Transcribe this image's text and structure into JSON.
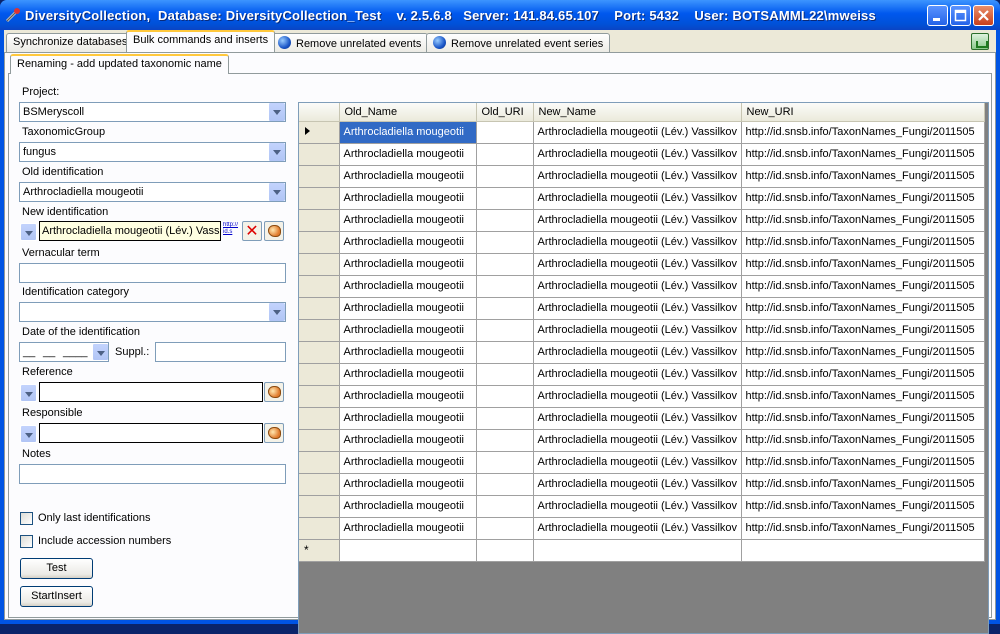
{
  "window": {
    "title": "DiversityCollection,  Database: DiversityCollection_Test    v. 2.5.6.8   Server: 141.84.65.107    Port: 5432    User: BOTSAMML22\\mweiss"
  },
  "tabs": [
    {
      "label": "Synchronize databases"
    },
    {
      "label": "Bulk commands and inserts"
    },
    {
      "label": "Remove unrelated events"
    },
    {
      "label": "Remove unrelated event series"
    }
  ],
  "subtab": {
    "label": "Renaming - add updated taxonomic name"
  },
  "form": {
    "project_label": "Project:",
    "project_value": "BSMeryscoll",
    "taxonomic_group_label": "TaxonomicGroup",
    "taxonomic_group_value": "fungus",
    "old_identification_label": "Old identification",
    "old_identification_value": "Arthrocladiella mougeotii",
    "new_identification_label": "New identification",
    "new_identification_value": "Arthrocladiella mougeotii (Lév.) Vassil",
    "new_identification_link": "http://id.s",
    "vernacular_label": "Vernacular term",
    "vernacular_value": "",
    "category_label": "Identification category",
    "category_value": "",
    "date_label": "Date of the identification",
    "date_day": "__",
    "date_month": "__",
    "date_year": "____",
    "suppl_label": "Suppl.:",
    "suppl_value": "",
    "reference_label": "Reference",
    "reference_value": "",
    "responsible_label": "Responsible",
    "responsible_value": "",
    "notes_label": "Notes",
    "notes_value": "",
    "only_last_label": "Only last identifications",
    "only_last_checked": false,
    "include_accession_label": "Include accession numbers",
    "include_accession_checked": false,
    "test_button": "Test",
    "start_button": "StartInsert"
  },
  "grid": {
    "columns": [
      "Old_Name",
      "Old_URI",
      "New_Name",
      "New_URI"
    ],
    "rows": [
      [
        "Arthrocladiella mougeotii",
        "",
        "Arthrocladiella mougeotii (Lév.) Vassilkov",
        "http://id.snsb.info/TaxonNames_Fungi/2011505"
      ],
      [
        "Arthrocladiella mougeotii",
        "",
        "Arthrocladiella mougeotii (Lév.) Vassilkov",
        "http://id.snsb.info/TaxonNames_Fungi/2011505"
      ],
      [
        "Arthrocladiella mougeotii",
        "",
        "Arthrocladiella mougeotii (Lév.) Vassilkov",
        "http://id.snsb.info/TaxonNames_Fungi/2011505"
      ],
      [
        "Arthrocladiella mougeotii",
        "",
        "Arthrocladiella mougeotii (Lév.) Vassilkov",
        "http://id.snsb.info/TaxonNames_Fungi/2011505"
      ],
      [
        "Arthrocladiella mougeotii",
        "",
        "Arthrocladiella mougeotii (Lév.) Vassilkov",
        "http://id.snsb.info/TaxonNames_Fungi/2011505"
      ],
      [
        "Arthrocladiella mougeotii",
        "",
        "Arthrocladiella mougeotii (Lév.) Vassilkov",
        "http://id.snsb.info/TaxonNames_Fungi/2011505"
      ],
      [
        "Arthrocladiella mougeotii",
        "",
        "Arthrocladiella mougeotii (Lév.) Vassilkov",
        "http://id.snsb.info/TaxonNames_Fungi/2011505"
      ],
      [
        "Arthrocladiella mougeotii",
        "",
        "Arthrocladiella mougeotii (Lév.) Vassilkov",
        "http://id.snsb.info/TaxonNames_Fungi/2011505"
      ],
      [
        "Arthrocladiella mougeotii",
        "",
        "Arthrocladiella mougeotii (Lév.) Vassilkov",
        "http://id.snsb.info/TaxonNames_Fungi/2011505"
      ],
      [
        "Arthrocladiella mougeotii",
        "",
        "Arthrocladiella mougeotii (Lév.) Vassilkov",
        "http://id.snsb.info/TaxonNames_Fungi/2011505"
      ],
      [
        "Arthrocladiella mougeotii",
        "",
        "Arthrocladiella mougeotii (Lév.) Vassilkov",
        "http://id.snsb.info/TaxonNames_Fungi/2011505"
      ],
      [
        "Arthrocladiella mougeotii",
        "",
        "Arthrocladiella mougeotii (Lév.) Vassilkov",
        "http://id.snsb.info/TaxonNames_Fungi/2011505"
      ],
      [
        "Arthrocladiella mougeotii",
        "",
        "Arthrocladiella mougeotii (Lév.) Vassilkov",
        "http://id.snsb.info/TaxonNames_Fungi/2011505"
      ],
      [
        "Arthrocladiella mougeotii",
        "",
        "Arthrocladiella mougeotii (Lév.) Vassilkov",
        "http://id.snsb.info/TaxonNames_Fungi/2011505"
      ],
      [
        "Arthrocladiella mougeotii",
        "",
        "Arthrocladiella mougeotii (Lév.) Vassilkov",
        "http://id.snsb.info/TaxonNames_Fungi/2011505"
      ],
      [
        "Arthrocladiella mougeotii",
        "",
        "Arthrocladiella mougeotii (Lév.) Vassilkov",
        "http://id.snsb.info/TaxonNames_Fungi/2011505"
      ],
      [
        "Arthrocladiella mougeotii",
        "",
        "Arthrocladiella mougeotii (Lév.) Vassilkov",
        "http://id.snsb.info/TaxonNames_Fungi/2011505"
      ],
      [
        "Arthrocladiella mougeotii",
        "",
        "Arthrocladiella mougeotii (Lév.) Vassilkov",
        "http://id.snsb.info/TaxonNames_Fungi/2011505"
      ],
      [
        "Arthrocladiella mougeotii",
        "",
        "Arthrocladiella mougeotii (Lév.) Vassilkov",
        "http://id.snsb.info/TaxonNames_Fungi/2011505"
      ]
    ],
    "new_row_marker": "*"
  }
}
